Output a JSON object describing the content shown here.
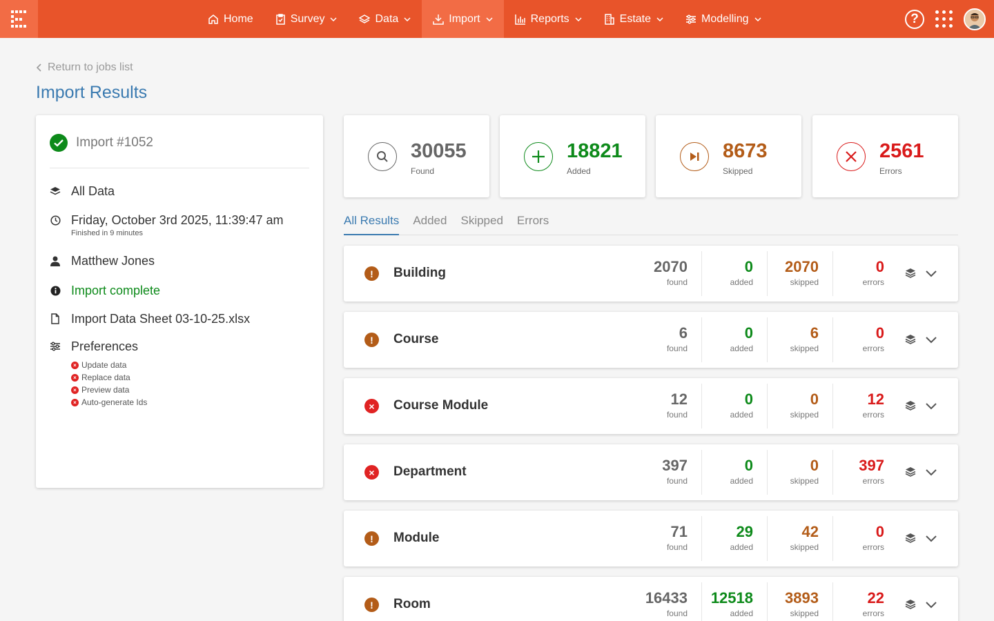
{
  "nav": {
    "items": [
      {
        "label": "Home",
        "icon": "home-icon",
        "dropdown": false,
        "active": false
      },
      {
        "label": "Survey",
        "icon": "clipboard-icon",
        "dropdown": true,
        "active": false
      },
      {
        "label": "Data",
        "icon": "layers-icon",
        "dropdown": true,
        "active": false
      },
      {
        "label": "Import",
        "icon": "download-icon",
        "dropdown": true,
        "active": true
      },
      {
        "label": "Reports",
        "icon": "bar-chart-icon",
        "dropdown": true,
        "active": false
      },
      {
        "label": "Estate",
        "icon": "building-icon",
        "dropdown": true,
        "active": false
      },
      {
        "label": "Modelling",
        "icon": "sliders-icon",
        "dropdown": true,
        "active": false
      }
    ],
    "help_glyph": "?"
  },
  "header": {
    "back_label": "Return to jobs list",
    "title": "Import Results"
  },
  "summary": {
    "import_id": "Import #1052",
    "dataset": "All Data",
    "datetime": "Friday, October 3rd 2025, 11:39:47 am",
    "duration": "Finished in 9 minutes",
    "user": "Matthew Jones",
    "status": "Import complete",
    "file": "Import Data Sheet 03-10-25.xlsx",
    "preferences_label": "Preferences",
    "preferences": [
      "Update data",
      "Replace data",
      "Preview data",
      "Auto-generate Ids"
    ]
  },
  "stats": [
    {
      "value": "30055",
      "label": "Found",
      "icon": "search-icon",
      "color": "#666666"
    },
    {
      "value": "18821",
      "label": "Added",
      "icon": "plus-icon",
      "color": "#0d8a1a"
    },
    {
      "value": "8673",
      "label": "Skipped",
      "icon": "skip-icon",
      "color": "#b35c18"
    },
    {
      "value": "2561",
      "label": "Errors",
      "icon": "close-icon",
      "color": "#d91a1a"
    }
  ],
  "tabs": [
    {
      "label": "All Results",
      "active": true
    },
    {
      "label": "Added",
      "active": false
    },
    {
      "label": "Skipped",
      "active": false
    },
    {
      "label": "Errors",
      "active": false
    }
  ],
  "column_labels": {
    "found": "found",
    "added": "added",
    "skipped": "skipped",
    "errors": "errors"
  },
  "results": [
    {
      "name": "Building",
      "status": "warning",
      "found": "2070",
      "added": "0",
      "skipped": "2070",
      "errors": "0"
    },
    {
      "name": "Course",
      "status": "warning",
      "found": "6",
      "added": "0",
      "skipped": "6",
      "errors": "0"
    },
    {
      "name": "Course Module",
      "status": "error",
      "found": "12",
      "added": "0",
      "skipped": "0",
      "errors": "12"
    },
    {
      "name": "Department",
      "status": "error",
      "found": "397",
      "added": "0",
      "skipped": "0",
      "errors": "397"
    },
    {
      "name": "Module",
      "status": "warning",
      "found": "71",
      "added": "29",
      "skipped": "42",
      "errors": "0"
    },
    {
      "name": "Room",
      "status": "warning",
      "found": "16433",
      "added": "12518",
      "skipped": "3893",
      "errors": "22"
    }
  ],
  "colors": {
    "brand": "#e8542a",
    "brand_active": "#f26c45",
    "title_blue": "#3a7ab0",
    "warning": "#b35c18",
    "error": "#e02323",
    "success": "#0d8a1a"
  }
}
